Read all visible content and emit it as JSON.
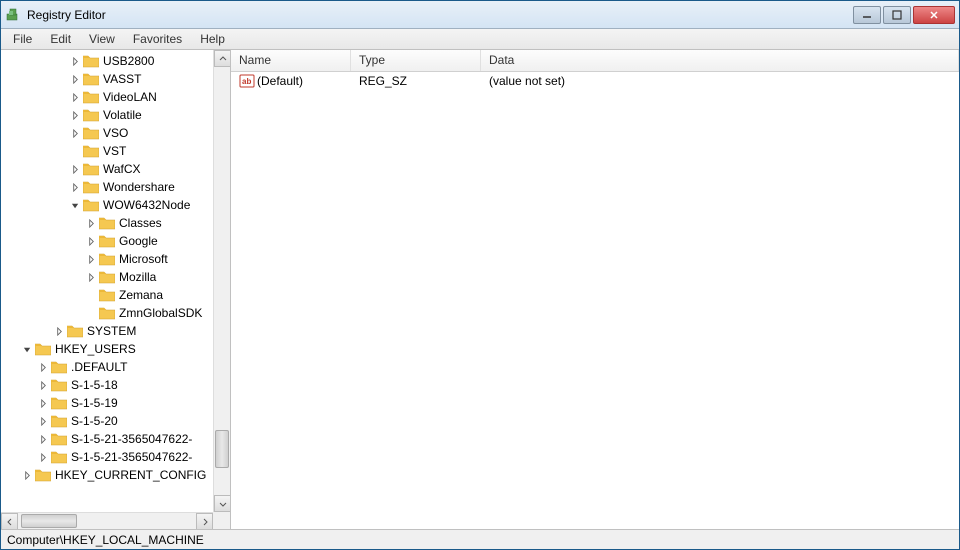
{
  "window": {
    "title": "Registry Editor"
  },
  "menu": {
    "file": "File",
    "edit": "Edit",
    "view": "View",
    "favorites": "Favorites",
    "help": "Help"
  },
  "tree": [
    {
      "indent": 4,
      "exp": "closed",
      "label": "USB2800"
    },
    {
      "indent": 4,
      "exp": "closed",
      "label": "VASST"
    },
    {
      "indent": 4,
      "exp": "closed",
      "label": "VideoLAN"
    },
    {
      "indent": 4,
      "exp": "closed",
      "label": "Volatile"
    },
    {
      "indent": 4,
      "exp": "closed",
      "label": "VSO"
    },
    {
      "indent": 4,
      "exp": "none",
      "label": "VST"
    },
    {
      "indent": 4,
      "exp": "closed",
      "label": "WafCX"
    },
    {
      "indent": 4,
      "exp": "closed",
      "label": "Wondershare"
    },
    {
      "indent": 4,
      "exp": "open",
      "label": "WOW6432Node"
    },
    {
      "indent": 5,
      "exp": "closed",
      "label": "Classes"
    },
    {
      "indent": 5,
      "exp": "closed",
      "label": "Google"
    },
    {
      "indent": 5,
      "exp": "closed",
      "label": "Microsoft"
    },
    {
      "indent": 5,
      "exp": "closed",
      "label": "Mozilla"
    },
    {
      "indent": 5,
      "exp": "none",
      "label": "Zemana"
    },
    {
      "indent": 5,
      "exp": "none",
      "label": "ZmnGlobalSDK"
    },
    {
      "indent": 3,
      "exp": "closed",
      "label": "SYSTEM"
    },
    {
      "indent": 1,
      "exp": "open",
      "label": "HKEY_USERS"
    },
    {
      "indent": 2,
      "exp": "closed",
      "label": ".DEFAULT"
    },
    {
      "indent": 2,
      "exp": "closed",
      "label": "S-1-5-18"
    },
    {
      "indent": 2,
      "exp": "closed",
      "label": "S-1-5-19"
    },
    {
      "indent": 2,
      "exp": "closed",
      "label": "S-1-5-20"
    },
    {
      "indent": 2,
      "exp": "closed",
      "label": "S-1-5-21-3565047622-"
    },
    {
      "indent": 2,
      "exp": "closed",
      "label": "S-1-5-21-3565047622-"
    },
    {
      "indent": 1,
      "exp": "closed",
      "label": "HKEY_CURRENT_CONFIG"
    }
  ],
  "list": {
    "columns": {
      "name": "Name",
      "type": "Type",
      "data": "Data"
    },
    "rows": [
      {
        "name": "(Default)",
        "type": "REG_SZ",
        "data": "(value not set)"
      }
    ]
  },
  "statusbar": "Computer\\HKEY_LOCAL_MACHINE"
}
